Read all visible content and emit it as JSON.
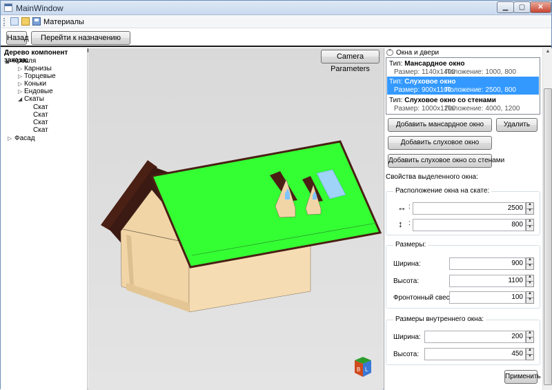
{
  "window": {
    "title": "MainWindow"
  },
  "toolbar": {
    "menu_label": "Материалы"
  },
  "nav": {
    "back_label": "Назад",
    "goto_label": "Перейти к назначению материалов"
  },
  "tree": {
    "title": "Дерево компонент заказа:",
    "roof": "Кровля",
    "roof_children": [
      "Карнизы",
      "Торцевые",
      "Коньки",
      "Ендовые",
      "Скаты"
    ],
    "slopes": [
      "Скат",
      "Скат",
      "Скат",
      "Скат"
    ],
    "facade": "Фасад"
  },
  "viewport": {
    "camera_button": "Camera Parameters",
    "roof_color": "#33ff33",
    "wall_color": "#f2d5a6",
    "trim_color": "#4a1f14",
    "cube_letters": [
      "B",
      "L"
    ]
  },
  "panel": {
    "section_title": "Окна и двери",
    "type_prefix": "Тип:",
    "size_prefix": "Размер:",
    "pos_prefix": "Положение:",
    "windows": [
      {
        "type": "Мансардное окно",
        "size": "1140x1400",
        "position": "1000, 800"
      },
      {
        "type": "Слуховое окно",
        "size": "900x1100",
        "position": "2500, 800"
      },
      {
        "type": "Слуховое окно со стенами",
        "size": "1000x1200",
        "position": "4000, 1200"
      }
    ],
    "selected_index": 1,
    "add_mansard": "Добавить мансардное окно",
    "delete": "Удалить",
    "add_dormer": "Добавить слуховое окно",
    "add_walled": "Добавить слуховое окно со стенами",
    "props_label": "Свойства выделенного окна:",
    "position_group": "Расположение окна на скате:",
    "pos_h": "2500",
    "pos_v": "800",
    "size_group": "Размеры:",
    "width_label": "Ширина:",
    "width": "900",
    "height_label": "Высота:",
    "height": "1100",
    "gable_label": "Фронтонный свес:",
    "gable": "100",
    "inner_group": "Размеры внутреннего окна:",
    "inner_width_label": "Ширина:",
    "inner_width": "200",
    "inner_height_label": "Высота:",
    "inner_height": "450",
    "apply": "Применить"
  }
}
